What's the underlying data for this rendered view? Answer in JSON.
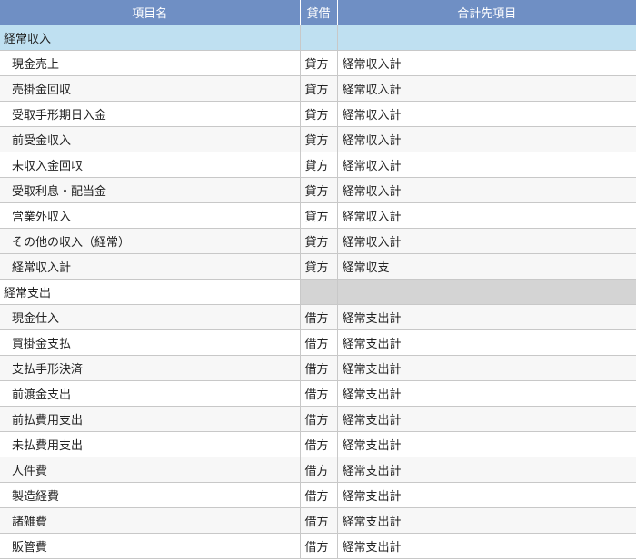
{
  "header": {
    "col_item": "項目名",
    "col_dc": "貸借",
    "col_target": "合計先項目"
  },
  "section1": {
    "label": "経常収入"
  },
  "income_rows": [
    {
      "name": "現金売上",
      "dc": "貸方",
      "target": "経常収入計"
    },
    {
      "name": "売掛金回収",
      "dc": "貸方",
      "target": "経常収入計"
    },
    {
      "name": "受取手形期日入金",
      "dc": "貸方",
      "target": "経常収入計"
    },
    {
      "name": "前受金収入",
      "dc": "貸方",
      "target": "経常収入計"
    },
    {
      "name": "未収入金回収",
      "dc": "貸方",
      "target": "経常収入計"
    },
    {
      "name": "受取利息・配当金",
      "dc": "貸方",
      "target": "経常収入計"
    },
    {
      "name": "営業外収入",
      "dc": "貸方",
      "target": "経常収入計"
    },
    {
      "name": "その他の収入（経常）",
      "dc": "貸方",
      "target": "経常収入計"
    }
  ],
  "income_total": {
    "name": "経常収入計",
    "dc": "貸方",
    "target": "経常収支"
  },
  "section2": {
    "label": "経常支出"
  },
  "expense_rows": [
    {
      "name": "現金仕入",
      "dc": "借方",
      "target": "経常支出計"
    },
    {
      "name": "買掛金支払",
      "dc": "借方",
      "target": "経常支出計"
    },
    {
      "name": "支払手形決済",
      "dc": "借方",
      "target": "経常支出計"
    },
    {
      "name": "前渡金支出",
      "dc": "借方",
      "target": "経常支出計"
    },
    {
      "name": "前払費用支出",
      "dc": "借方",
      "target": "経常支出計"
    },
    {
      "name": "未払費用支出",
      "dc": "借方",
      "target": "経常支出計"
    },
    {
      "name": "人件費",
      "dc": "借方",
      "target": "経常支出計"
    },
    {
      "name": "製造経費",
      "dc": "借方",
      "target": "経常支出計"
    },
    {
      "name": "諸雑費",
      "dc": "借方",
      "target": "経常支出計"
    },
    {
      "name": "販管費",
      "dc": "借方",
      "target": "経常支出計"
    }
  ]
}
